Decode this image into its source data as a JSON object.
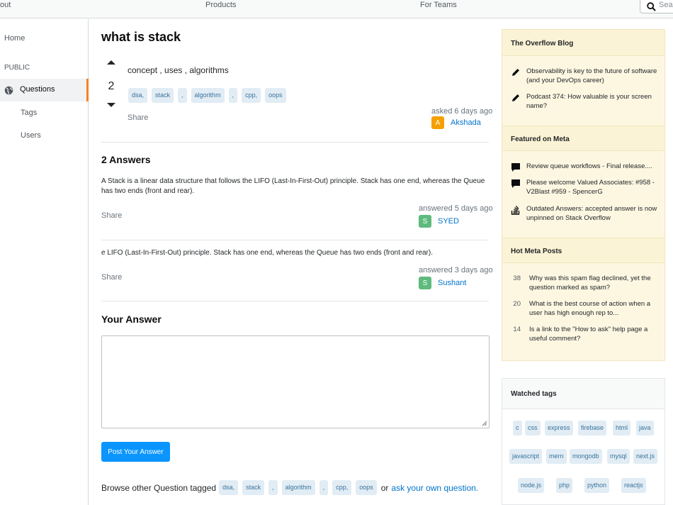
{
  "topbar": {
    "about": "out",
    "products": "Products",
    "for_teams": "For Teams",
    "search_placeholder": "Sear"
  },
  "sidebar": {
    "home": "Home",
    "public": "PUBLIC",
    "questions": "Questions",
    "tags": "Tags",
    "users": "Users"
  },
  "question": {
    "title": "what is stack",
    "votes": "2",
    "body": "concept , uses , algorithms",
    "tags": [
      "dsa,",
      "stack",
      ",",
      "algorithm",
      ",",
      "cpp,",
      "oops"
    ],
    "share": "Share",
    "asked": "asked 6 days ago",
    "user_initial": "A",
    "user_name": "Akshada"
  },
  "answers": {
    "heading": "2 Answers",
    "items": [
      {
        "text": "A Stack is a linear data structure that follows the LIFO (Last-In-First-Out) principle. Stack has one end, whereas the Queue has two ends (front and rear).",
        "share": "Share",
        "answered": "answered 5 days ago",
        "user_initial": "S",
        "user_name": "SYED"
      },
      {
        "text": "e LIFO (Last-In-First-Out) principle. Stack has one end, whereas the Queue has two ends (front and rear).",
        "share": "Share",
        "answered": "answered 3 days ago",
        "user_initial": "S",
        "user_name": "Sushant"
      }
    ]
  },
  "your_answer": {
    "heading": "Your Answer",
    "post_button": "Post Your Answer"
  },
  "browse": {
    "prefix": "Browse other Question tagged",
    "tags": [
      "dsa,",
      "stack",
      ",",
      "algorithm",
      ",",
      "cpp,",
      "oops"
    ],
    "or": "or",
    "ask_link": "ask your own question."
  },
  "right_sidebar": {
    "blog_heading": "The Overflow Blog",
    "blog_items": [
      "Observability is key to the future of software (and your DevOps career)",
      "Podcast 374: How valuable is your screen name?"
    ],
    "meta_heading": "Featured on Meta",
    "meta_items": [
      "Review queue workflows - Final release....",
      "Please welcome Valued Associates: #958 - V2Blast #959 - SpencerG",
      "Outdated Answers: accepted answer is now unpinned on Stack Overflow"
    ],
    "hot_heading": "Hot Meta Posts",
    "hot_items": [
      {
        "count": "38",
        "text": "Why was this spam flag declined, yet the question marked as spam?"
      },
      {
        "count": "20",
        "text": "What is the best course of action when a user has high enough rep to..."
      },
      {
        "count": "14",
        "text": "Is a link to the \"How to ask\" help page a useful comment?"
      }
    ],
    "watched_heading": "Watched tags",
    "watched_tags": [
      "c",
      "css",
      "express",
      "firebase",
      "html",
      "java",
      "javascript",
      "mern",
      "mongodb",
      "mysql",
      "next.js",
      "node.js",
      "php",
      "python",
      "reactjs"
    ]
  },
  "colors": {
    "accent_blue": "#0a95ff",
    "link_blue": "#0074cc",
    "tag_bg": "#e1ecf4",
    "tag_text": "#39739d",
    "active_orange": "#f48225",
    "blog_bg": "#fdf7e2",
    "avatar_akshada": "#f5a000",
    "avatar_s": "#5eba7d"
  }
}
